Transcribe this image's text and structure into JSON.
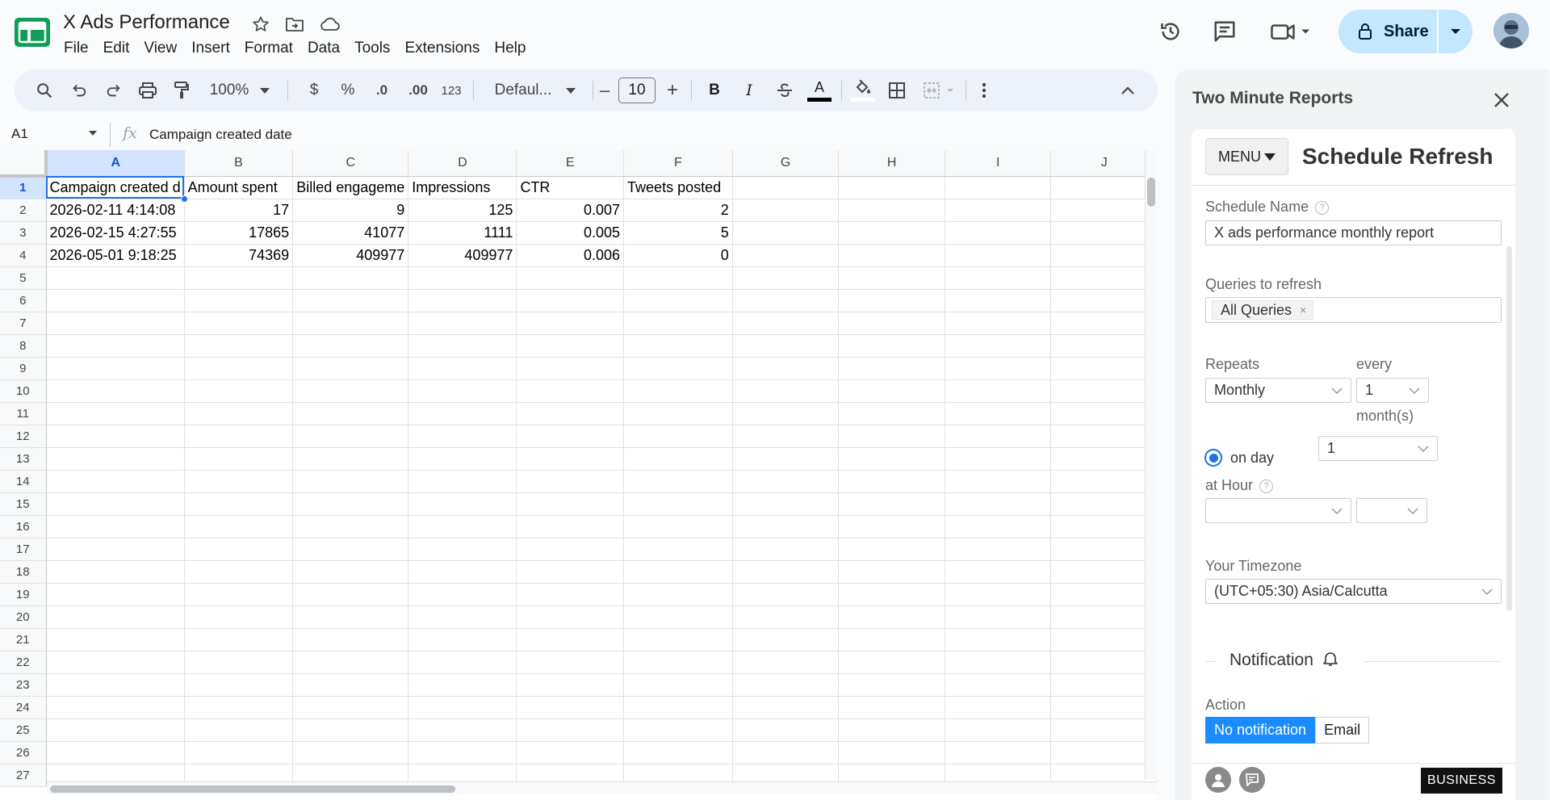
{
  "app": {
    "title": "X Ads Performance",
    "menu": [
      "File",
      "Edit",
      "View",
      "Insert",
      "Format",
      "Data",
      "Tools",
      "Extensions",
      "Help"
    ],
    "share_label": "Share",
    "brand_color": "#0f9d58",
    "accent_color": "#c2e7ff"
  },
  "toolbar": {
    "zoom": "100%",
    "currency": "$",
    "percent": "%",
    "decrease_decimals": ".0",
    "increase_decimals": ".00",
    "more_formats": "123",
    "font_name": "Defaul...",
    "font_size": "10",
    "minus": "–",
    "plus": "+",
    "bold": "B",
    "italic": "I",
    "text_color_glyph": "A"
  },
  "formula_bar": {
    "cell_ref": "A1",
    "fx": "fx",
    "content": "Campaign created date"
  },
  "grid": {
    "columns": [
      "A",
      "B",
      "C",
      "D",
      "E",
      "F",
      "G",
      "H",
      "I",
      "J"
    ],
    "selected_column": "A",
    "selected_row": 1,
    "row_count": 27,
    "header_row": [
      "Campaign created d",
      "Amount spent",
      "Billed engageme",
      "Impressions",
      "CTR",
      "Tweets posted"
    ],
    "rows": [
      [
        "2026-02-11 4:14:08",
        "17",
        "9",
        "125",
        "0.007",
        "2"
      ],
      [
        "2026-02-15 4:27:55",
        "17865",
        "41077",
        "1111",
        "0.005",
        "5"
      ],
      [
        "2026-05-01 9:18:25",
        "74369",
        "409977",
        "409977",
        "0.006",
        "0"
      ]
    ]
  },
  "panel": {
    "title": "Two Minute Reports",
    "menu_label": "MENU",
    "heading": "Schedule Refresh",
    "schedule_name_label": "Schedule Name",
    "schedule_name_value": "X ads performance monthly report",
    "queries_label": "Queries to refresh",
    "queries_tag": "All Queries",
    "queries_tag_remove": "×",
    "repeats_label": "Repeats",
    "repeats_value": "Monthly",
    "every_label": "every",
    "every_value": "1",
    "every_unit": "month(s)",
    "on_day_label": "on day",
    "on_day_value": "1",
    "at_hour_label": "at Hour",
    "at_hour_value": "",
    "at_minute_value": "",
    "timezone_label": "Your Timezone",
    "timezone_value": "(UTC+05:30) Asia/Calcutta",
    "notification_title": "Notification",
    "action_label": "Action",
    "action_options": [
      "No notification",
      "Email"
    ],
    "action_selected": "No notification",
    "badge": "BUSINESS",
    "accent_color": "#1a8cff"
  }
}
